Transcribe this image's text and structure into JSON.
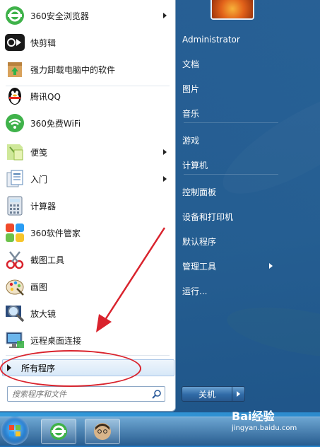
{
  "programs": [
    {
      "label": "360安全浏览器",
      "icon": "360-browser-icon",
      "has_submenu": true
    },
    {
      "label": "快剪辑",
      "icon": "kuaijianji-icon",
      "has_submenu": false
    },
    {
      "label": "强力卸载电脑中的软件",
      "icon": "uninstall-icon",
      "has_submenu": false
    },
    {
      "label": "腾讯QQ",
      "icon": "qq-penguin-icon",
      "has_submenu": false
    },
    {
      "label": "360免费WiFi",
      "icon": "360-wifi-icon",
      "has_submenu": false
    },
    {
      "label": "便笺",
      "icon": "sticky-notes-icon",
      "has_submenu": true
    },
    {
      "label": "入门",
      "icon": "getting-started-icon",
      "has_submenu": true
    },
    {
      "label": "计算器",
      "icon": "calculator-icon",
      "has_submenu": false
    },
    {
      "label": "360软件管家",
      "icon": "360-software-manager-icon",
      "has_submenu": false
    },
    {
      "label": "截图工具",
      "icon": "snipping-tool-icon",
      "has_submenu": false
    },
    {
      "label": "画图",
      "icon": "paint-icon",
      "has_submenu": false
    },
    {
      "label": "放大镜",
      "icon": "magnifier-icon",
      "has_submenu": false
    },
    {
      "label": "远程桌面连接",
      "icon": "remote-desktop-icon",
      "has_submenu": false
    }
  ],
  "all_programs_label": "所有程序",
  "search": {
    "placeholder": "搜索程序和文件"
  },
  "right_panel": [
    {
      "label": "Administrator",
      "has_submenu": false
    },
    {
      "label": "文档",
      "has_submenu": false
    },
    {
      "label": "图片",
      "has_submenu": false
    },
    {
      "label": "音乐",
      "has_submenu": false
    },
    {
      "label": "游戏",
      "has_submenu": false
    },
    {
      "label": "计算机",
      "has_submenu": false
    },
    {
      "label": "控制面板",
      "has_submenu": false
    },
    {
      "label": "设备和打印机",
      "has_submenu": false
    },
    {
      "label": "默认程序",
      "has_submenu": false
    },
    {
      "label": "管理工具",
      "has_submenu": true
    },
    {
      "label": "运行...",
      "has_submenu": false
    }
  ],
  "shutdown_label": "关机",
  "taskbar": {
    "pinned": [
      "360-browser-icon",
      "user-avatar-icon"
    ]
  },
  "watermark": {
    "brand": "Bai经验",
    "url": "jingyan.baidu.com"
  },
  "colors": {
    "annotation_red": "#d9232d",
    "menu_blue": "#2a6ea8"
  }
}
